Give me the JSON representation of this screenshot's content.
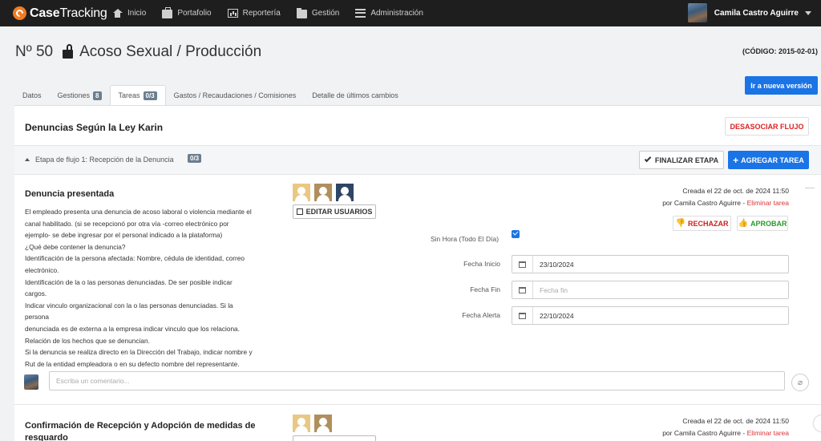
{
  "app": {
    "brand_bold": "Case",
    "brand_light": "Tracking",
    "nav": [
      {
        "label": "Inicio",
        "icon": "home-icon"
      },
      {
        "label": "Portafolio",
        "icon": "briefcase-icon"
      },
      {
        "label": "Reportería",
        "icon": "chart-icon"
      },
      {
        "label": "Gestión",
        "icon": "folder-icon"
      },
      {
        "label": "Administración",
        "icon": "menu-icon"
      }
    ],
    "user_name": "Camila Castro Aguirre"
  },
  "case": {
    "number": "Nº 50",
    "title": "Acoso Sexual / Producción",
    "code": "(CÓDIGO: 2015-02-01)",
    "new_version_button": "Ir a nueva versión"
  },
  "tabs": [
    {
      "label": "Datos",
      "badge": ""
    },
    {
      "label": "Gestiones",
      "badge": "8"
    },
    {
      "label": "Tareas",
      "badge": "0/3",
      "active": true
    },
    {
      "label": "Gastos / Recaudaciones / Comisiones",
      "badge": ""
    },
    {
      "label": "Detalle de últimos cambios",
      "badge": ""
    }
  ],
  "flow": {
    "title": "Denuncias Según la Ley Karin",
    "dissociate_button": "DESASOCIAR FLUJO",
    "stage_label": "Etapa de flujo 1: Recepción de la Denuncia",
    "stage_badge": "0/3",
    "finish_stage_button": "FINALIZAR ETAPA",
    "add_task_button": "AGREGAR TAREA"
  },
  "task1": {
    "title": "Denuncia presentada",
    "description_lines": [
      "El empleado presenta una denuncia de acoso laboral o violencia mediante el",
      "canal habilitado. (si se recepcionó por otra vía -correo electrónico por",
      "ejemplo- se debe ingresar por el personal indicado a la plataforma)",
      "¿Qué debe contener la denuncia?",
      "Identificación de la persona afectada: Nombre, cédula de identidad, correo",
      "electrónico.",
      "Identificación de la o las personas denunciadas. De ser posible indicar",
      "cargos.",
      "Indicar vinculo organizacional con la o las personas denunciadas. Si la",
      "persona",
      "denunciada es de externa a la empresa indicar vinculo que los relaciona.",
      "Relación de los hechos que se denuncian.",
      "Si la denuncia se realiza directo en la Dirección del Trabajo, indicar nombre y",
      "Rut de la entidad empleadora o en su defecto nombre del representante."
    ],
    "edit_users_button": "EDITAR USUARIOS",
    "created_line": "Creada el 22 de oct. de 2024 11:50",
    "created_by": "por Camila Castro Aguirre -",
    "delete_link": "Eliminar tarea",
    "reject_button": "RECHAZAR",
    "approve_button": "APROBAR",
    "all_day_label": "Sin Hora (Todo El Día)",
    "all_day_checked": true,
    "start_label": "Fecha Inicio",
    "start_value": "23/10/2024",
    "end_label": "Fecha Fin",
    "end_placeholder": "Fecha fin",
    "alert_label": "Fecha Alerta",
    "alert_value": "22/10/2024",
    "comment_placeholder": "Escriba un comentario..."
  },
  "task2": {
    "title": "Confirmación de Recepción y Adopción de medidas de resguardo",
    "created_line": "Creada el 22 de oct. de 2024 11:50",
    "created_by": "por Camila Castro Aguirre -",
    "delete_link": "Eliminar tarea"
  },
  "colors": {
    "primary": "#1a74e6",
    "danger": "#d22222",
    "success": "#2a9a2a",
    "navbar": "#1e1e1e",
    "brand_orange": "#f07c22"
  }
}
